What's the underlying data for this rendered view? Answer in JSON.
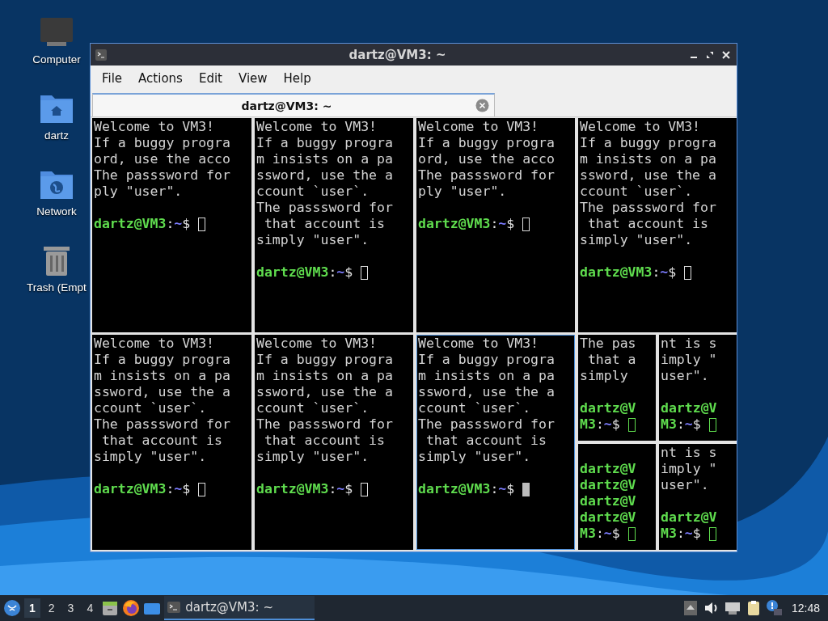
{
  "desktop": {
    "icons": [
      {
        "label": "Computer",
        "kind": "computer"
      },
      {
        "label": "dartz",
        "kind": "home"
      },
      {
        "label": "Network",
        "kind": "network"
      },
      {
        "label": "Trash (Empt",
        "kind": "trash"
      }
    ]
  },
  "window": {
    "title": "dartz@VM3: ~",
    "menu": [
      "File",
      "Actions",
      "Edit",
      "View",
      "Help"
    ],
    "tabs": [
      {
        "label": "dartz@VM3: ~",
        "selected": true
      }
    ],
    "rows": [
      {
        "items": [
          {
            "kind": "terminal",
            "selected": false,
            "lines": [
              {
                "kind": "text",
                "text": "Welcome to VM3!"
              },
              {
                "kind": "text",
                "text": "If a buggy progra"
              },
              {
                "kind": "text",
                "text": "ord, use the acco"
              },
              {
                "kind": "text",
                "text": "The passsword for"
              },
              {
                "kind": "text",
                "text": "ply \"user\"."
              },
              {
                "kind": "blank"
              },
              {
                "kind": "prompt",
                "user": "dartz@VM3",
                "sep": ":",
                "path": "~",
                "sign": "$"
              }
            ]
          },
          {
            "kind": "terminal",
            "selected": false,
            "lines": [
              {
                "kind": "text",
                "text": "Welcome to VM3!"
              },
              {
                "kind": "text",
                "text": "If a buggy progra"
              },
              {
                "kind": "text",
                "text": "m insists on a pa"
              },
              {
                "kind": "text",
                "text": "ssword, use the a"
              },
              {
                "kind": "text",
                "text": "ccount `user`."
              },
              {
                "kind": "text",
                "text": "The passsword for"
              },
              {
                "kind": "text",
                "text": " that account is"
              },
              {
                "kind": "text",
                "text": "simply \"user\"."
              },
              {
                "kind": "blank"
              },
              {
                "kind": "prompt",
                "user": "dartz@VM3",
                "sep": ":",
                "path": "~",
                "sign": "$"
              }
            ]
          },
          {
            "kind": "terminal",
            "selected": false,
            "lines": [
              {
                "kind": "text",
                "text": "Welcome to VM3!"
              },
              {
                "kind": "text",
                "text": "If a buggy progra"
              },
              {
                "kind": "text",
                "text": "ord, use the acco"
              },
              {
                "kind": "text",
                "text": "The passsword for"
              },
              {
                "kind": "text",
                "text": "ply \"user\"."
              },
              {
                "kind": "blank"
              },
              {
                "kind": "prompt",
                "user": "dartz@VM3",
                "sep": ":",
                "path": "~",
                "sign": "$"
              }
            ]
          },
          {
            "kind": "terminal",
            "selected": false,
            "lines": [
              {
                "kind": "text",
                "text": "Welcome to VM3!"
              },
              {
                "kind": "text",
                "text": "If a buggy progra"
              },
              {
                "kind": "text",
                "text": "m insists on a pa"
              },
              {
                "kind": "text",
                "text": "ssword, use the a"
              },
              {
                "kind": "text",
                "text": "ccount `user`."
              },
              {
                "kind": "text",
                "text": "The passsword for"
              },
              {
                "kind": "text",
                "text": " that account is"
              },
              {
                "kind": "text",
                "text": "simply \"user\"."
              },
              {
                "kind": "blank"
              },
              {
                "kind": "prompt",
                "user": "dartz@VM3",
                "sep": ":",
                "path": "~",
                "sign": "$"
              }
            ]
          }
        ]
      },
      {
        "items": [
          {
            "kind": "terminal",
            "selected": false,
            "lines": [
              {
                "kind": "text",
                "text": "Welcome to VM3!"
              },
              {
                "kind": "text",
                "text": "If a buggy progra"
              },
              {
                "kind": "text",
                "text": "m insists on a pa"
              },
              {
                "kind": "text",
                "text": "ssword, use the a"
              },
              {
                "kind": "text",
                "text": "ccount `user`."
              },
              {
                "kind": "text",
                "text": "The passsword for"
              },
              {
                "kind": "text",
                "text": " that account is"
              },
              {
                "kind": "text",
                "text": "simply \"user\"."
              },
              {
                "kind": "blank"
              },
              {
                "kind": "prompt",
                "user": "dartz@VM3",
                "sep": ":",
                "path": "~",
                "sign": "$"
              }
            ]
          },
          {
            "kind": "terminal",
            "selected": false,
            "lines": [
              {
                "kind": "text",
                "text": "Welcome to VM3!"
              },
              {
                "kind": "text",
                "text": "If a buggy progra"
              },
              {
                "kind": "text",
                "text": "m insists on a pa"
              },
              {
                "kind": "text",
                "text": "ssword, use the a"
              },
              {
                "kind": "text",
                "text": "ccount `user`."
              },
              {
                "kind": "text",
                "text": "The passsword for"
              },
              {
                "kind": "text",
                "text": " that account is"
              },
              {
                "kind": "text",
                "text": "simply \"user\"."
              },
              {
                "kind": "blank"
              },
              {
                "kind": "prompt",
                "user": "dartz@VM3",
                "sep": ":",
                "path": "~",
                "sign": "$"
              }
            ]
          },
          {
            "kind": "terminal",
            "selected": true,
            "lines": [
              {
                "kind": "text",
                "text": "Welcome to VM3!"
              },
              {
                "kind": "text",
                "text": "If a buggy progra"
              },
              {
                "kind": "text",
                "text": "m insists on a pa"
              },
              {
                "kind": "text",
                "text": "ssword, use the a"
              },
              {
                "kind": "text",
                "text": "ccount `user`."
              },
              {
                "kind": "text",
                "text": "The passsword for"
              },
              {
                "kind": "text",
                "text": " that account is"
              },
              {
                "kind": "text",
                "text": "simply \"user\"."
              },
              {
                "kind": "blank"
              },
              {
                "kind": "prompt",
                "user": "dartz@VM3",
                "sep": ":",
                "path": "~",
                "sign": "$"
              }
            ]
          },
          {
            "kind": "grid",
            "rows": [
              {
                "panes": [
                  {
                    "kind": "terminal",
                    "selected": false,
                    "lines": [
                      {
                        "kind": "text",
                        "text": "The pas"
                      },
                      {
                        "kind": "text",
                        "text": " that a"
                      },
                      {
                        "kind": "text",
                        "text": "simply"
                      },
                      {
                        "kind": "blank"
                      },
                      {
                        "kind": "user",
                        "text": "dartz@V"
                      },
                      {
                        "kind": "prompt",
                        "user": "M3",
                        "sep": ":",
                        "path": "~",
                        "sign": "$"
                      }
                    ]
                  },
                  {
                    "kind": "terminal",
                    "selected": false,
                    "lines": [
                      {
                        "kind": "text",
                        "text": "nt is s"
                      },
                      {
                        "kind": "text",
                        "text": "imply \""
                      },
                      {
                        "kind": "text",
                        "text": "user\"."
                      },
                      {
                        "kind": "blank"
                      },
                      {
                        "kind": "user",
                        "text": "dartz@V"
                      },
                      {
                        "kind": "prompt",
                        "user": "M3",
                        "sep": ":",
                        "path": "~",
                        "sign": "$"
                      }
                    ]
                  }
                ]
              },
              {
                "panes": [
                  {
                    "kind": "terminal",
                    "selected": false,
                    "lines": [
                      {
                        "kind": "blank"
                      },
                      {
                        "kind": "user",
                        "text": "dartz@V"
                      },
                      {
                        "kind": "user",
                        "text": "dartz@V"
                      },
                      {
                        "kind": "user",
                        "text": "dartz@V"
                      },
                      {
                        "kind": "user",
                        "text": "dartz@V"
                      },
                      {
                        "kind": "prompt",
                        "user": "M3",
                        "sep": ":",
                        "path": "~",
                        "sign": "$"
                      }
                    ]
                  },
                  {
                    "kind": "terminal",
                    "selected": false,
                    "lines": [
                      {
                        "kind": "text",
                        "text": "nt is s"
                      },
                      {
                        "kind": "text",
                        "text": "imply \""
                      },
                      {
                        "kind": "text",
                        "text": "user\"."
                      },
                      {
                        "kind": "blank"
                      },
                      {
                        "kind": "user",
                        "text": "dartz@V"
                      },
                      {
                        "kind": "prompt",
                        "user": "M3",
                        "sep": ":",
                        "path": "~",
                        "sign": "$"
                      }
                    ]
                  }
                ]
              }
            ]
          }
        ]
      }
    ]
  },
  "taskbar": {
    "workspaces": [
      {
        "label": "1",
        "selected": true
      },
      {
        "label": "2",
        "selected": false
      },
      {
        "label": "3",
        "selected": false
      },
      {
        "label": "4",
        "selected": false
      }
    ],
    "tasks": [
      {
        "label": "dartz@VM3: ~",
        "selected": true
      }
    ],
    "clock": "12:48"
  }
}
